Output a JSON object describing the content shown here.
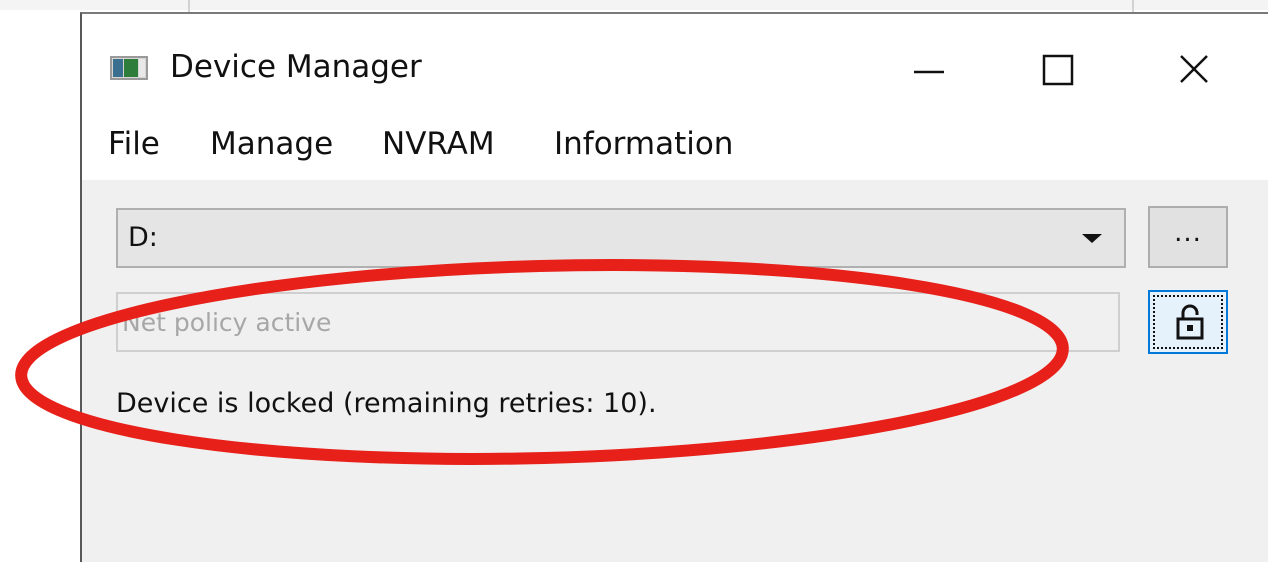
{
  "window": {
    "title": "Device Manager",
    "icon": "device-manager-app-icon",
    "controls": {
      "minimize_icon": "minimize-icon",
      "maximize_icon": "maximize-icon",
      "close_icon": "close-icon"
    }
  },
  "menu": {
    "items": [
      {
        "label": "File"
      },
      {
        "label": "Manage"
      },
      {
        "label": "NVRAM"
      },
      {
        "label": "Information"
      }
    ]
  },
  "device_selector": {
    "value": "D:",
    "dropdown_icon": "chevron-down-icon"
  },
  "browse_button": {
    "label": "..."
  },
  "password": {
    "placeholder": "Net policy active",
    "value": ""
  },
  "unlock_button": {
    "icon": "unlock-icon",
    "focused": true
  },
  "status": {
    "message": "Device is locked (remaining retries: 10)."
  },
  "annotation": {
    "shape": "ellipse",
    "color": "#e8201a"
  },
  "colors": {
    "window_bg": "#f0f0f0",
    "titlebar_bg": "#ffffff",
    "focus_border": "#0078d7",
    "annotation": "#e8201a"
  }
}
